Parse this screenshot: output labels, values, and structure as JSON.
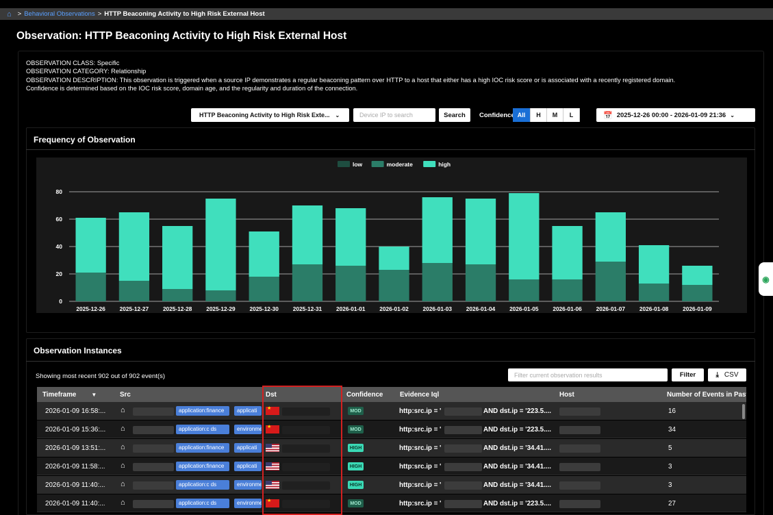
{
  "breadcrumb": {
    "home_icon": "home-icon",
    "separator": ">",
    "link": "Behavioral Observations",
    "current": "HTTP Beaconing Activity to High Risk External Host"
  },
  "title": "Observation: HTTP Beaconing Activity to High Risk External Host",
  "info": {
    "class_line": "OBSERVATION CLASS: Specific",
    "category_line": "OBSERVATION CATEGORY: Relationship",
    "description_line": "OBSERVATION DESCRIPTION: This observation is triggered when a source IP demonstrates a regular beaconing pattern over HTTP to a host that either has a high IOC risk score or is associated with a recently registered domain.",
    "confidence_line": "Confidence is determined based on the IOC risk score, domain age, and the regularity and duration of the connection."
  },
  "controls": {
    "observation_select": "HTTP Beaconing Activity to High Risk Exte...",
    "search_placeholder": "Device IP to search",
    "search_label": "Search",
    "confidence_label": "Confidence",
    "confidence_options": [
      "All",
      "H",
      "M",
      "L"
    ],
    "confidence_selected": "All",
    "date_range": "2025-12-26 00:00  -  2026-01-09 21:36"
  },
  "frequency": {
    "title": "Frequency of Observation"
  },
  "chart_data": {
    "type": "bar",
    "stacked": true,
    "categories": [
      "2025-12-26",
      "2025-12-27",
      "2025-12-28",
      "2025-12-29",
      "2025-12-30",
      "2025-12-31",
      "2026-01-01",
      "2026-01-02",
      "2026-01-03",
      "2026-01-04",
      "2026-01-05",
      "2026-01-06",
      "2026-01-07",
      "2026-01-08",
      "2026-01-09"
    ],
    "series": [
      {
        "name": "low",
        "color": "#1e4d40",
        "values": [
          0,
          0,
          0,
          0,
          0,
          0,
          0,
          0,
          0,
          0,
          0,
          0,
          0,
          0,
          0
        ]
      },
      {
        "name": "moderate",
        "color": "#2b7d68",
        "values": [
          21,
          15,
          9,
          8,
          18,
          27,
          26,
          23,
          28,
          27,
          16,
          16,
          29,
          13,
          12
        ]
      },
      {
        "name": "high",
        "color": "#40dfbd",
        "values": [
          40,
          50,
          46,
          67,
          33,
          43,
          42,
          17,
          48,
          48,
          63,
          39,
          36,
          28,
          14
        ]
      }
    ],
    "ylim": [
      0,
      90
    ],
    "yticks": [
      0,
      20,
      40,
      60,
      80
    ],
    "legend_position": "top",
    "grid": true
  },
  "instances": {
    "title": "Observation Instances",
    "showing": "Showing most recent 902 out of 902 event(s)",
    "filter_placeholder": "Filter current observation results",
    "filter_label": "Filter",
    "csv_label": "CSV",
    "columns": [
      "Timeframe",
      "Src",
      "Dst",
      "Confidence",
      "Evidence Iql",
      "Host",
      "Number of Events in Past"
    ],
    "rows": [
      {
        "time": "2026-01-09 16:58:...",
        "tag1": "application:finance",
        "tag2": "applicati",
        "flag": "cn",
        "conf": "MOD",
        "iql_left": "http:src.ip = '",
        "iql_right": "AND dst.ip = '223.5....",
        "events": "16"
      },
      {
        "time": "2026-01-09 15:36:...",
        "tag1": "application:c ds",
        "tag2": "environmen",
        "flag": "cn",
        "conf": "MOD",
        "iql_left": "http:src.ip = '",
        "iql_right": "AND dst.ip = '223.5....",
        "events": "34"
      },
      {
        "time": "2026-01-09 13:51:...",
        "tag1": "application:finance",
        "tag2": "applicati",
        "flag": "us",
        "conf": "HIGH",
        "iql_left": "http:src.ip = '",
        "iql_right": "AND dst.ip = '34.41....",
        "events": "5"
      },
      {
        "time": "2026-01-09 11:58:...",
        "tag1": "application:finance",
        "tag2": "applicati",
        "flag": "us",
        "conf": "HIGH",
        "iql_left": "http:src.ip = '",
        "iql_right": "AND dst.ip = '34.41....",
        "events": "3"
      },
      {
        "time": "2026-01-09 11:40:...",
        "tag1": "application:c ds",
        "tag2": "environmen",
        "flag": "us",
        "conf": "HIGH",
        "iql_left": "http:src.ip = '",
        "iql_right": "AND dst.ip = '34.41....",
        "events": "3"
      },
      {
        "time": "2026-01-09 11:40:...",
        "tag1": "application:c ds",
        "tag2": "environmen",
        "flag": "cn",
        "conf": "MOD",
        "iql_left": "http:src.ip = '",
        "iql_right": "AND dst.ip = '223.5....",
        "events": "27"
      }
    ]
  }
}
